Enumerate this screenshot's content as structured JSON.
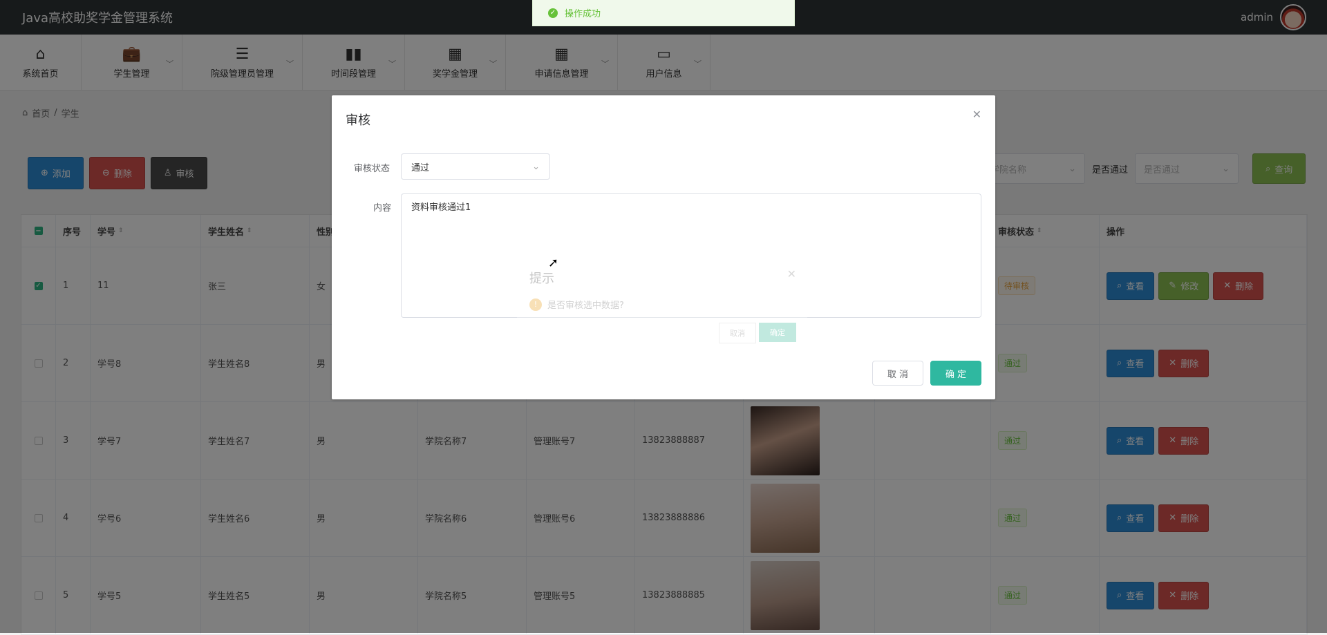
{
  "app": {
    "title": "Java高校助奖学金管理系统",
    "user": "admin"
  },
  "nav": [
    {
      "label": "系统首页",
      "icon": "home-icon"
    },
    {
      "label": "学生管理",
      "icon": "briefcase-icon"
    },
    {
      "label": "院级管理员管理",
      "icon": "sliders-icon"
    },
    {
      "label": "时间段管理",
      "icon": "book-icon"
    },
    {
      "label": "奖学金管理",
      "icon": "grid-icon"
    },
    {
      "label": "申请信息管理",
      "icon": "grid-icon"
    },
    {
      "label": "用户信息",
      "icon": "wallet-icon"
    }
  ],
  "breadcrumb": {
    "home": "首页",
    "separator": "/",
    "current": "学生"
  },
  "toolbar": {
    "add": "添加",
    "delete": "删除",
    "review": "审核"
  },
  "search": {
    "college_placeholder": "学院名称",
    "passed_label": "是否通过",
    "passed_placeholder": "是否通过",
    "query": "查询"
  },
  "table": {
    "headers": {
      "no": "序号",
      "student_id": "学号",
      "name": "学生姓名",
      "sex": "性别",
      "status": "审核状态",
      "ops": "操作"
    },
    "rows": [
      {
        "no": "1",
        "student_id": "11",
        "name": "张三",
        "sex": "女",
        "college": "",
        "account": "",
        "phone": "",
        "status": "待审核",
        "checked": true,
        "has_edit": true
      },
      {
        "no": "2",
        "student_id": "学号8",
        "name": "学生姓名8",
        "sex": "男",
        "college": "",
        "account": "",
        "phone": "",
        "status": "通过",
        "checked": false
      },
      {
        "no": "3",
        "student_id": "学号7",
        "name": "学生姓名7",
        "sex": "男",
        "college": "学院名称7",
        "account": "管理账号7",
        "phone": "13823888887",
        "status": "通过",
        "checked": false
      },
      {
        "no": "4",
        "student_id": "学号6",
        "name": "学生姓名6",
        "sex": "男",
        "college": "学院名称6",
        "account": "管理账号6",
        "phone": "13823888886",
        "status": "通过",
        "checked": false
      },
      {
        "no": "5",
        "student_id": "学号5",
        "name": "学生姓名5",
        "sex": "男",
        "college": "学院名称5",
        "account": "管理账号5",
        "phone": "13823888885",
        "status": "通过",
        "checked": false
      }
    ],
    "op_labels": {
      "view": "查看",
      "edit": "修改",
      "delete": "删除"
    }
  },
  "toast": {
    "message": "操作成功"
  },
  "dialog": {
    "title": "审核",
    "status_label": "审核状态",
    "status_value": "通过",
    "content_label": "内容",
    "content_value": "资料审核通过1",
    "cancel": "取 消",
    "confirm": "确 定"
  },
  "prompt": {
    "title": "提示",
    "message": "是否审核选中数据?",
    "cancel": "取消",
    "confirm": "确定"
  },
  "colors": {
    "header_bg": "#2e3436",
    "primary_blue": "#2d8cd7",
    "danger_red": "#d9534f",
    "dark": "#4a4a4a",
    "success_green": "#8cc152",
    "confirm_teal": "#2fb8a0"
  }
}
